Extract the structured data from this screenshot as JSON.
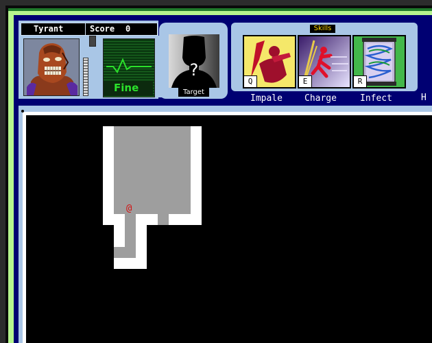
{
  "hud": {
    "character_name": "Tyrant",
    "score_label": "Score",
    "score_value": "0",
    "health_status": "Fine",
    "target_label": "Target",
    "target_unknown_mark": "?",
    "skills_title": "Skills",
    "skills": [
      {
        "key": "Q",
        "name": "Impale",
        "icon": "impale-icon",
        "bg": "#f5e66a"
      },
      {
        "key": "E",
        "name": "Charge",
        "icon": "charge-icon",
        "bg": "#7d59a8"
      },
      {
        "key": "R",
        "name": "Infect",
        "icon": "infect-icon",
        "bg": "#56c45a"
      }
    ],
    "cut_off_text": "H"
  },
  "map": {
    "player_glyph": "@",
    "colors": {
      "wall": "#ffffff",
      "floor": "#9e9e9e",
      "player": "#d21414"
    }
  }
}
